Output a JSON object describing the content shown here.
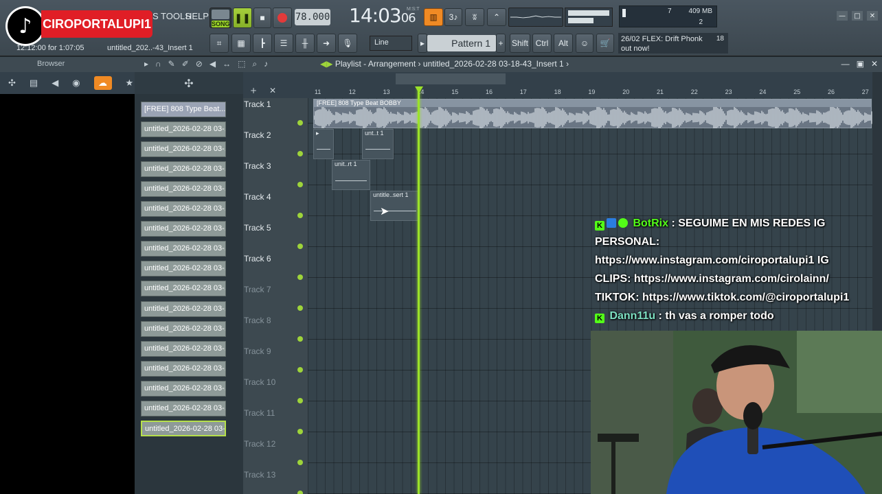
{
  "overlay": {
    "tiktok_handle": "CIROPORTALUPI1"
  },
  "toolbar": {
    "menu_tools": "S TOOLS",
    "menu_help": "HELP",
    "hint_time": "12:12:00 for 1:07:05",
    "hint_project": "untitled_202..-43_Insert 1",
    "song_label": "SONG",
    "tempo": "78.000",
    "time_main": "14:03",
    "time_small": "06",
    "time_unit": "M:S:T",
    "pattern_label": "Pattern 1",
    "snap_value": "Line",
    "shift": "Shift",
    "ctrl": "Ctrl",
    "alt": "Alt",
    "cpu_mem": "409 MB",
    "cpu_val1": "7",
    "cpu_val2": "2",
    "news_line1": "26/02  FLEX: Drift Phonk",
    "news_line2": "out now!",
    "news_count": "18"
  },
  "browser": {
    "title": "Browser"
  },
  "picker": {
    "clips": [
      "[FREE] 808 Type Beat...",
      "untitled_2026-02-28 03-...",
      "untitled_2026-02-28 03-...",
      "untitled_2026-02-28 03-...",
      "untitled_2026-02-28 03-...",
      "untitled_2026-02-28 03-...",
      "untitled_2026-02-28 03-...",
      "untitled_2026-02-28 03-...",
      "untitled_2026-02-28 03-...",
      "untitled_2026-02-28 03-...",
      "untitled_2026-02-28 03-...",
      "untitled_2026-02-28 03-...",
      "untitled_2026-02-28 03-...",
      "untitled_2026-02-28 03-...",
      "untitled_2026-02-28 03-...",
      "untitled_2026-02-28 03-...",
      "untitled_2026-02-28 03-..."
    ]
  },
  "playlist": {
    "title": "Playlist - Arrangement",
    "sep": "›",
    "project": "untitled_2026-02-28 03-18-43_Insert 1",
    "bars": [
      "11",
      "12",
      "13",
      "14",
      "15",
      "16",
      "17",
      "18",
      "19",
      "20",
      "21",
      "22",
      "23",
      "24",
      "25",
      "26",
      "27"
    ],
    "tracks": [
      "Track 1",
      "Track 2",
      "Track 3",
      "Track 4",
      "Track 5",
      "Track 6",
      "Track 7",
      "Track 8",
      "Track 9",
      "Track 10",
      "Track 11",
      "Track 12",
      "Track 13"
    ],
    "audio_clip": "[FREE] 808 Type Beat BOBBY",
    "pattern_clips": [
      "unt..t 1",
      "unit..rt 1",
      "untitle..sert 1"
    ]
  },
  "chat": {
    "msg1_user": "BotRix",
    "msg1_text": ": SEGUIME EN MIS REDES IG PERSONAL:",
    "msg1_link1": "https://www.instagram.com/ciroportalupi1 IG",
    "msg1_link2": "CLIPS: https://www.instagram.com/cirolainn/",
    "msg1_link3": "TIKTOK: https://www.tiktok.com/@ciroportalupi1",
    "msg2_user": "Dann11u",
    "msg2_text": ": th vas a romper todo"
  },
  "colors": {
    "accent_green": "#9be22a",
    "kick_green": "#53fc18",
    "tiktok_red": "#e01e26",
    "fl_orange": "#f08a24"
  }
}
